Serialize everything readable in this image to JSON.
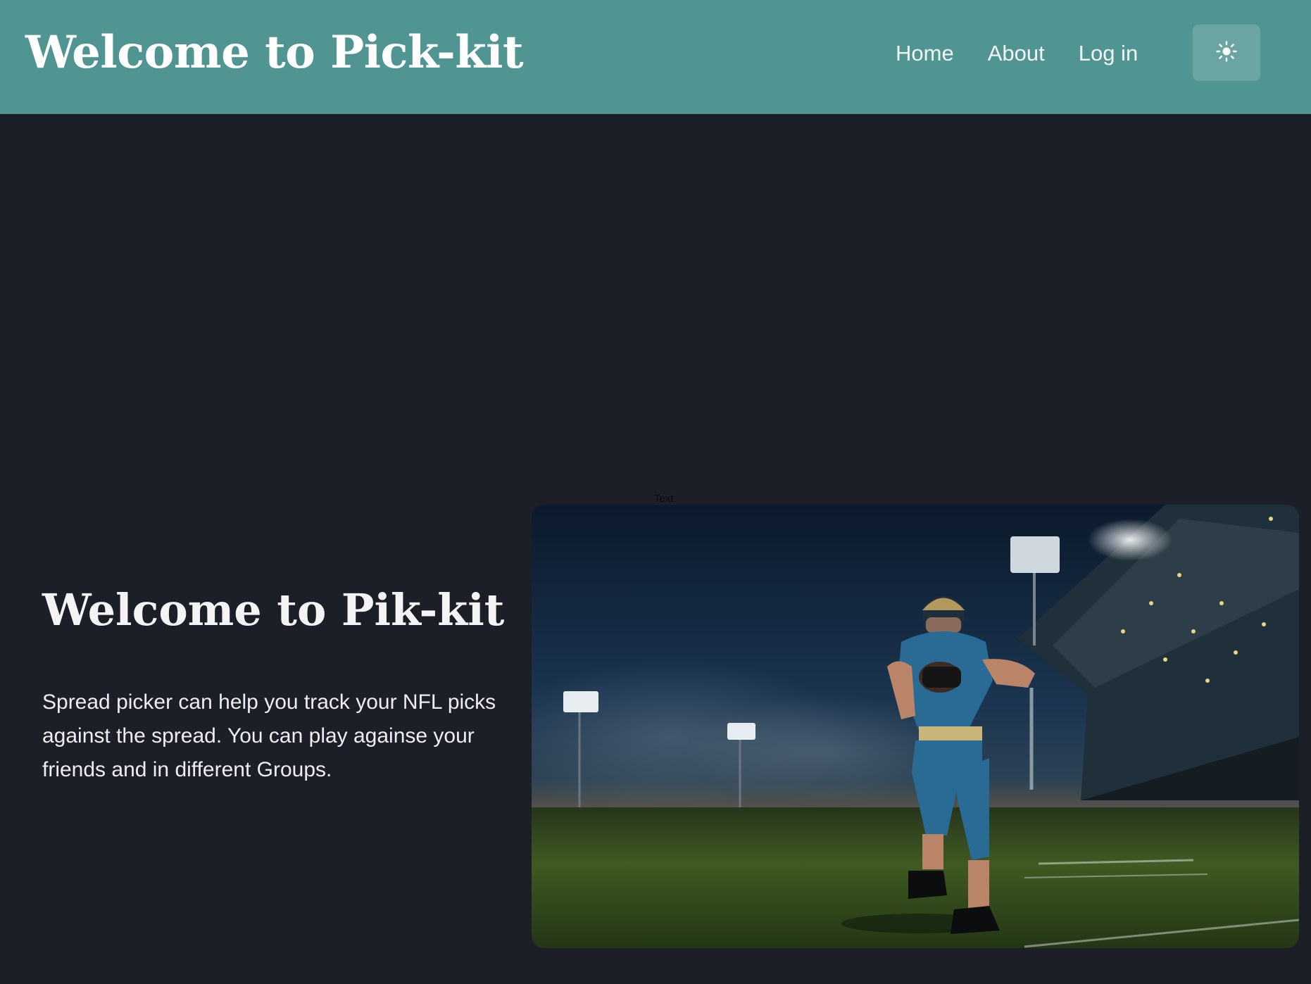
{
  "header": {
    "title": "Welcome to Pick-kit",
    "nav": [
      {
        "label": "Home"
      },
      {
        "label": "About"
      },
      {
        "label": "Log in"
      }
    ],
    "theme_toggle_icon": "sun-icon"
  },
  "hero": {
    "heading": "Welcome to Pik-kit",
    "description": "Spread picker can help you track your NFL picks against the spread. You can play againse your friends and in different Groups.",
    "image_caption": "Text",
    "image_subject": "football-player-illustration"
  },
  "colors": {
    "header_bg": "#519592",
    "page_bg": "#1c1f28",
    "toggle_bg": "#6aa5a2",
    "text": "#ffffff"
  }
}
